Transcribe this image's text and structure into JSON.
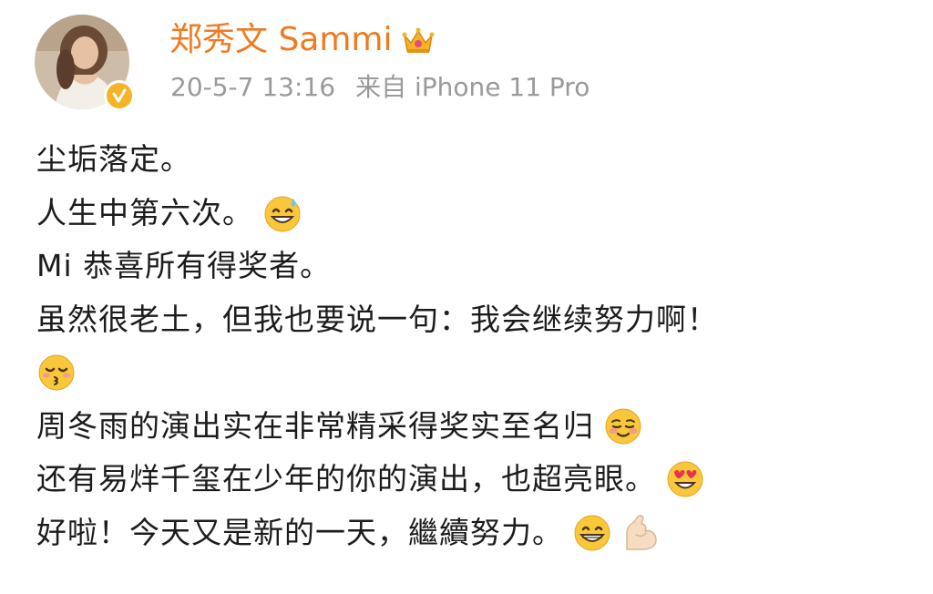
{
  "user": {
    "name": "郑秀文 Sammi",
    "badge_icon": "crown-icon",
    "verified_icon": "verified-icon",
    "brand_color": "#f07a1e"
  },
  "meta": {
    "time": "20-5-7 13:16",
    "source": "来自 iPhone 11 Pro"
  },
  "post": {
    "lines": [
      {
        "text": "尘垢落定。",
        "emoji": []
      },
      {
        "text": "人生中第六次。",
        "emoji": [
          "grinning-sweat-emoji"
        ]
      },
      {
        "text": "Mi 恭喜所有得奖者。",
        "emoji": []
      },
      {
        "text": "虽然很老土，但我也要说一句：我会继续努力啊！",
        "emoji": []
      },
      {
        "text": "",
        "emoji": [
          "kissing-emoji"
        ]
      },
      {
        "text": "周冬雨的演出实在非常精采得奖实至名归",
        "emoji": [
          "smiling-blush-emoji"
        ]
      },
      {
        "text": "还有易烊千玺在少年的你的演出，也超亮眼。",
        "emoji": [
          "heart-eyes-emoji"
        ]
      },
      {
        "text": "好啦！今天又是新的一天，繼續努力。",
        "emoji": [
          "grin-emoji",
          "flexed-biceps-emoji"
        ]
      }
    ]
  }
}
